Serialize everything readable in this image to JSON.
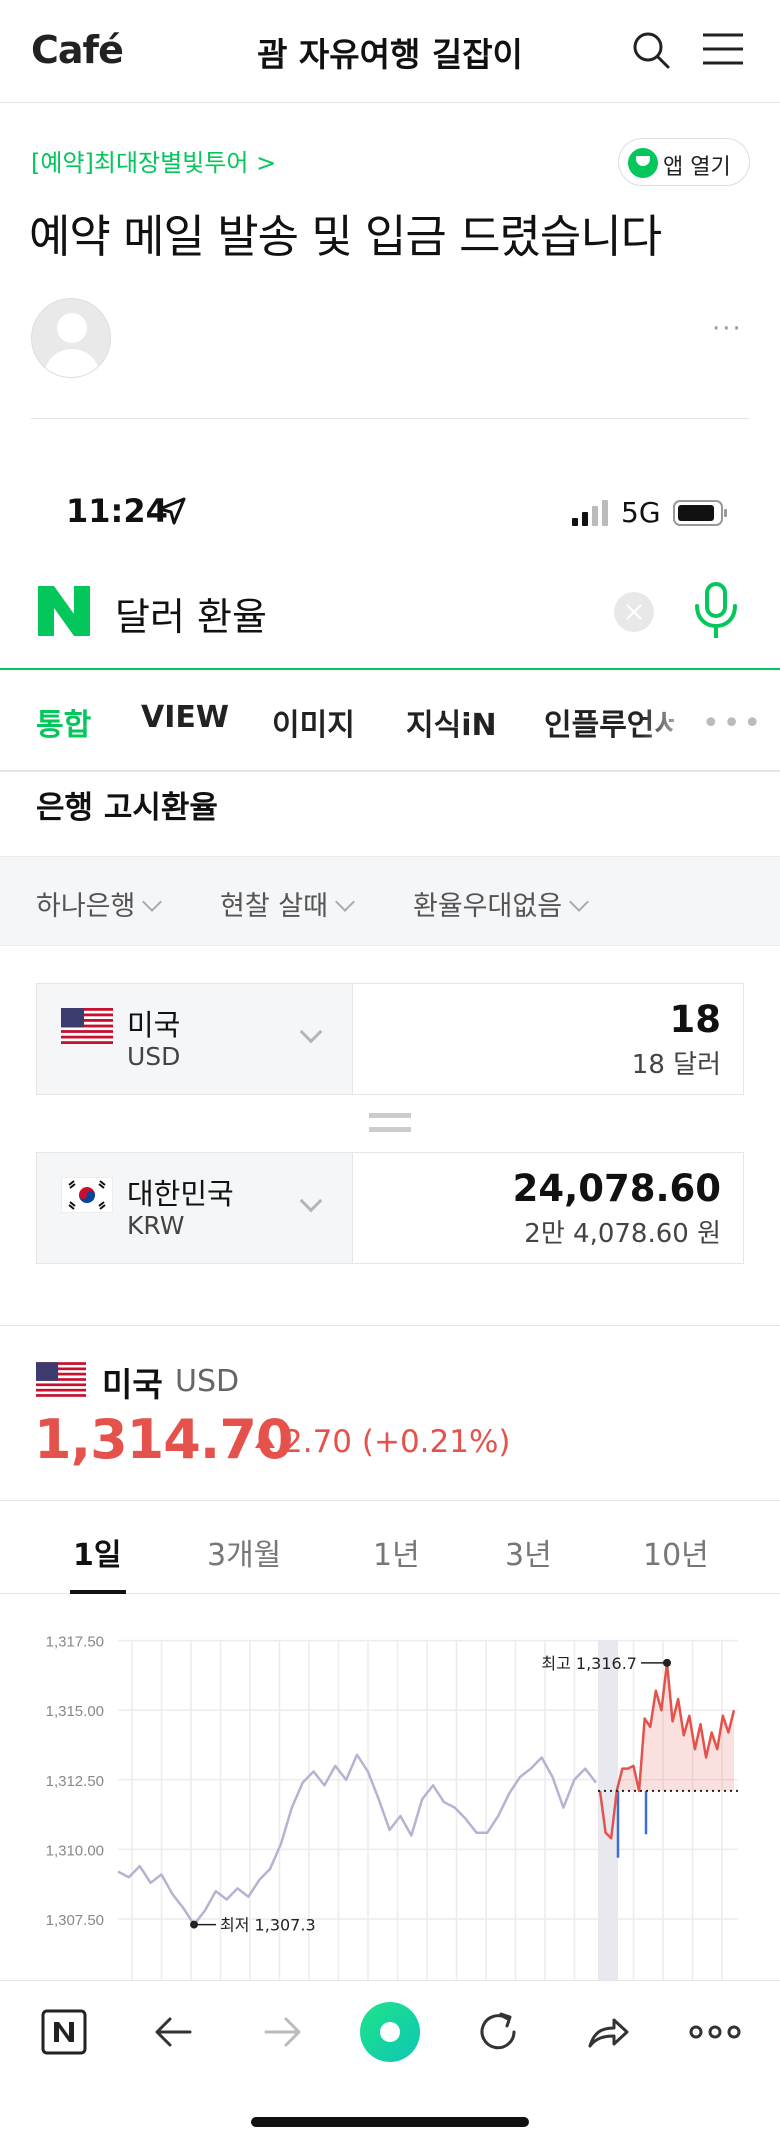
{
  "cafe": {
    "logo_text": "Café",
    "title": "괌 자유여행 길잡이"
  },
  "article": {
    "category": "[예약]최대장별빛투어 >",
    "app_open_label": "앱 열기",
    "title": "예약 메일 발송 및 입금 드렸습니다",
    "more": "···"
  },
  "status_bar": {
    "time": "11:24",
    "network": "5G"
  },
  "search": {
    "query": "달러 환율"
  },
  "tabs": [
    "통합",
    "VIEW",
    "이미지",
    "지식iN",
    "인플루언서"
  ],
  "tabs_more": "•••",
  "section_title": "은행 고시환율",
  "filters": [
    "하나은행",
    "현찰 살때",
    "환율우대없음"
  ],
  "converter": {
    "from": {
      "country": "미국",
      "code": "USD",
      "value": "18",
      "sub": "18 달러"
    },
    "to": {
      "country": "대한민국",
      "code": "KRW",
      "value": "24,078.60",
      "sub": "2만 4,078.60 원"
    }
  },
  "rate_info": {
    "country": "미국",
    "code": "USD",
    "rate": "1,314.70",
    "change": "2.70 (+0.21%)"
  },
  "periods": [
    "1일",
    "3개월",
    "1년",
    "3년",
    "10년"
  ],
  "chart_data": {
    "type": "line",
    "yticks": [
      "1,317.50",
      "1,315.00",
      "1,312.50",
      "1,310.00",
      "1,307.50"
    ],
    "ylim": [
      1306.5,
      1318
    ],
    "annotations": {
      "max_label": "최고 1,316.7",
      "min_label": "최저 1,307.3"
    },
    "series": [
      {
        "values": [
          1309.2,
          1309.0,
          1309.4,
          1308.8,
          1309.1,
          1308.4,
          1307.9,
          1307.3,
          1307.8,
          1308.5,
          1308.2,
          1308.6,
          1308.3,
          1308.9,
          1309.3,
          1310.2,
          1311.5,
          1312.4,
          1312.8,
          1312.3,
          1313.0,
          1312.5,
          1313.4,
          1312.8,
          1311.8,
          1310.7,
          1311.2,
          1310.5,
          1311.8,
          1312.3,
          1311.7,
          1311.5,
          1311.1,
          1310.6,
          1310.6,
          1311.2,
          1312.0,
          1312.6,
          1312.9,
          1313.3,
          1312.6,
          1311.5,
          1312.5,
          1312.9,
          1312.4
        ]
      },
      {
        "values": [
          1312.1,
          1310.6,
          1310.4,
          1312.1,
          1312.9,
          1312.9,
          1313.0,
          1312.1,
          1314.7,
          1314.4,
          1315.7,
          1315.0,
          1316.7,
          1314.6,
          1315.4,
          1314.1,
          1314.8,
          1313.6,
          1314.5,
          1313.3,
          1314.2,
          1313.6,
          1314.8,
          1314.2,
          1315.0
        ]
      }
    ]
  },
  "bottom_bar": [
    "naver-home",
    "back",
    "forward",
    "green-dot",
    "refresh",
    "share",
    "more"
  ]
}
